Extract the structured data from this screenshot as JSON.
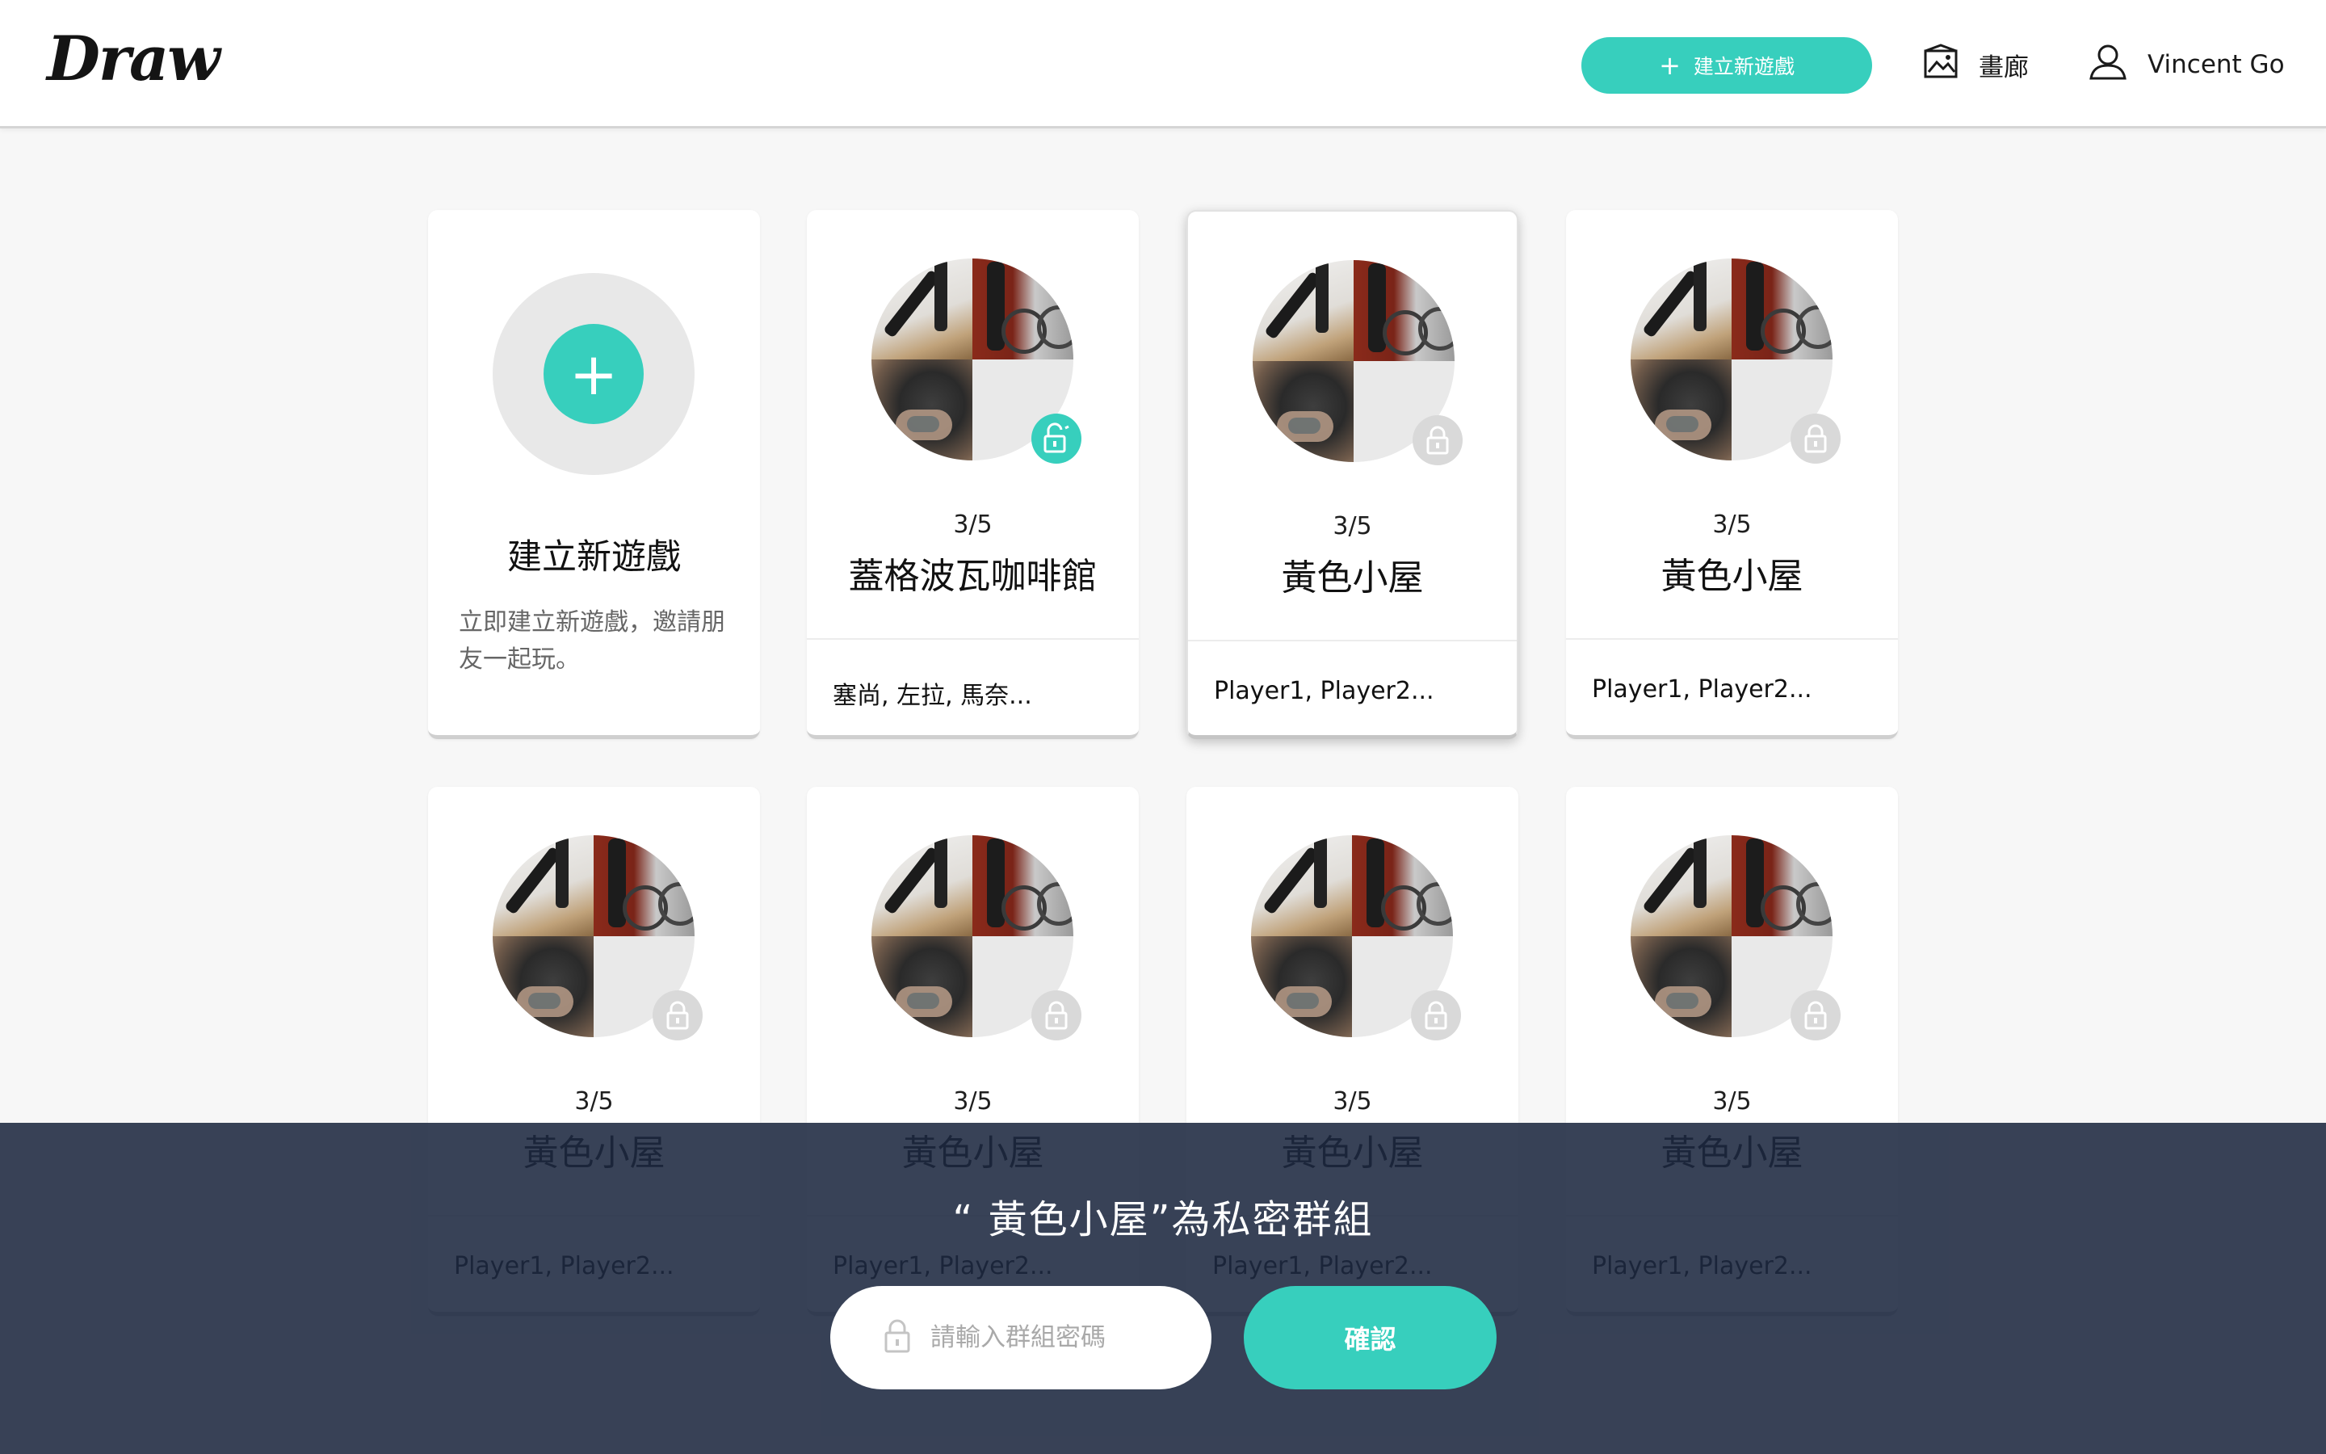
{
  "header": {
    "logo": "Draw",
    "new_game_label": "建立新遊戲",
    "gallery_label": "畫廊",
    "user_name": "Vincent Go"
  },
  "create_card": {
    "title": "建立新遊戲",
    "description": "立即建立新遊戲，邀請朋友一起玩。"
  },
  "rooms": [
    {
      "count": "3/5",
      "name": "蓋格波瓦咖啡館",
      "players": "塞尚, 左拉, 馬奈...",
      "lock": "unlocked"
    },
    {
      "count": "3/5",
      "name": "黃色小屋",
      "players": "Player1, Player2...",
      "lock": "locked"
    },
    {
      "count": "3/5",
      "name": "黃色小屋",
      "players": "Player1, Player2...",
      "lock": "locked"
    },
    {
      "count": "3/5",
      "name": "黃色小屋",
      "players": "Player1, Player2...",
      "lock": "locked"
    },
    {
      "count": "3/5",
      "name": "黃色小屋",
      "players": "Player1, Player2...",
      "lock": "locked"
    },
    {
      "count": "3/5",
      "name": "黃色小屋",
      "players": "Player1, Player2...",
      "lock": "locked"
    },
    {
      "count": "3/5",
      "name": "黃色小屋",
      "players": "Player1, Player2...",
      "lock": "locked"
    }
  ],
  "dialog": {
    "message": "“ 黃色小屋”為私密群組",
    "password_placeholder": "請輸入群組密碼",
    "password_value": "",
    "confirm_label": "確認"
  },
  "colors": {
    "accent": "#37cfbd",
    "overlay": "#1d2840",
    "background": "#f7f7f7",
    "lock_locked": "#d9d9d9"
  }
}
